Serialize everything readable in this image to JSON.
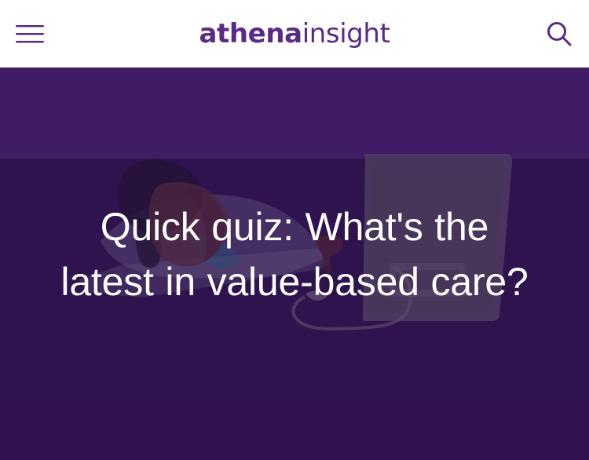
{
  "header": {
    "logo_bold": "athena",
    "logo_light": "insight",
    "menu_icon": "hamburger-menu-icon",
    "search_icon": "search-icon"
  },
  "hero": {
    "headline": "Quick quiz: What's the latest in value-based care?"
  },
  "colors": {
    "brand_purple": "#5b2a86",
    "hero_top": "#562a80",
    "hero_bottom": "#2f1450",
    "white": "#ffffff"
  }
}
